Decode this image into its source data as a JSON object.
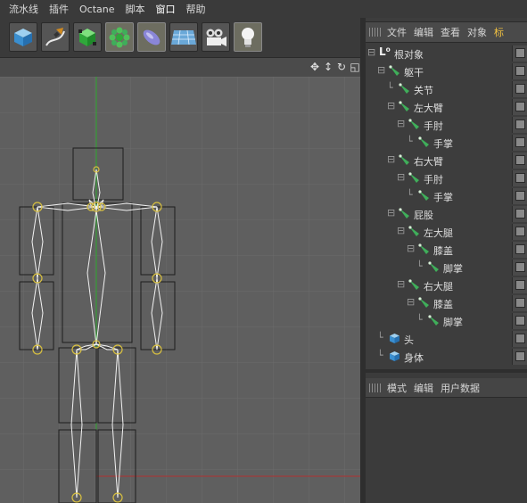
{
  "menubar": {
    "items": [
      "流水线",
      "插件",
      "Octane",
      "脚本",
      "窗口",
      "帮助"
    ]
  },
  "toolbar": {
    "buttons": [
      {
        "icon": "cube-icon",
        "name": "cube-button"
      },
      {
        "icon": "pen-icon",
        "name": "pen-button"
      },
      {
        "icon": "nurbs-icon",
        "name": "nurbs-button"
      },
      {
        "icon": "array-icon",
        "name": "array-button"
      },
      {
        "icon": "deformer-icon",
        "name": "deformer-button"
      },
      {
        "icon": "floor-icon",
        "name": "floor-button"
      },
      {
        "icon": "camera-icon",
        "name": "camera-button"
      },
      {
        "icon": "light-icon",
        "name": "light-button"
      }
    ]
  },
  "object_manager": {
    "menu": [
      "文件",
      "编辑",
      "查看",
      "对象",
      "标"
    ],
    "items": [
      {
        "label": "根对象",
        "type": "root",
        "depth": 0
      },
      {
        "label": "躯干",
        "type": "joint",
        "depth": 1
      },
      {
        "label": "关节",
        "type": "joint",
        "depth": 2
      },
      {
        "label": "左大臂",
        "type": "joint",
        "depth": 2
      },
      {
        "label": "手肘",
        "type": "joint",
        "depth": 3
      },
      {
        "label": "手掌",
        "type": "joint",
        "depth": 4
      },
      {
        "label": "右大臂",
        "type": "joint",
        "depth": 2
      },
      {
        "label": "手肘",
        "type": "joint",
        "depth": 3
      },
      {
        "label": "手掌",
        "type": "joint",
        "depth": 4
      },
      {
        "label": "屁股",
        "type": "joint",
        "depth": 2
      },
      {
        "label": "左大腿",
        "type": "joint",
        "depth": 3
      },
      {
        "label": "膝盖",
        "type": "joint",
        "depth": 4
      },
      {
        "label": "脚掌",
        "type": "joint",
        "depth": 5
      },
      {
        "label": "右大腿",
        "type": "joint",
        "depth": 3
      },
      {
        "label": "膝盖",
        "type": "joint",
        "depth": 4
      },
      {
        "label": "脚掌",
        "type": "joint",
        "depth": 5
      },
      {
        "label": "头",
        "type": "cube",
        "depth": 1
      },
      {
        "label": "身体",
        "type": "cube",
        "depth": 1
      }
    ]
  },
  "attribute_manager": {
    "menu": [
      "模式",
      "编辑",
      "用户数据"
    ]
  },
  "colors": {
    "accent": "#f0c040",
    "joint_green": "#3fae5a",
    "viewport_bg": "#5f5f5f",
    "grid_line": "#6a6a6a",
    "axis_green": "#2ea82e",
    "axis_red": "#b03030",
    "joint_circle": "#d8c040"
  }
}
